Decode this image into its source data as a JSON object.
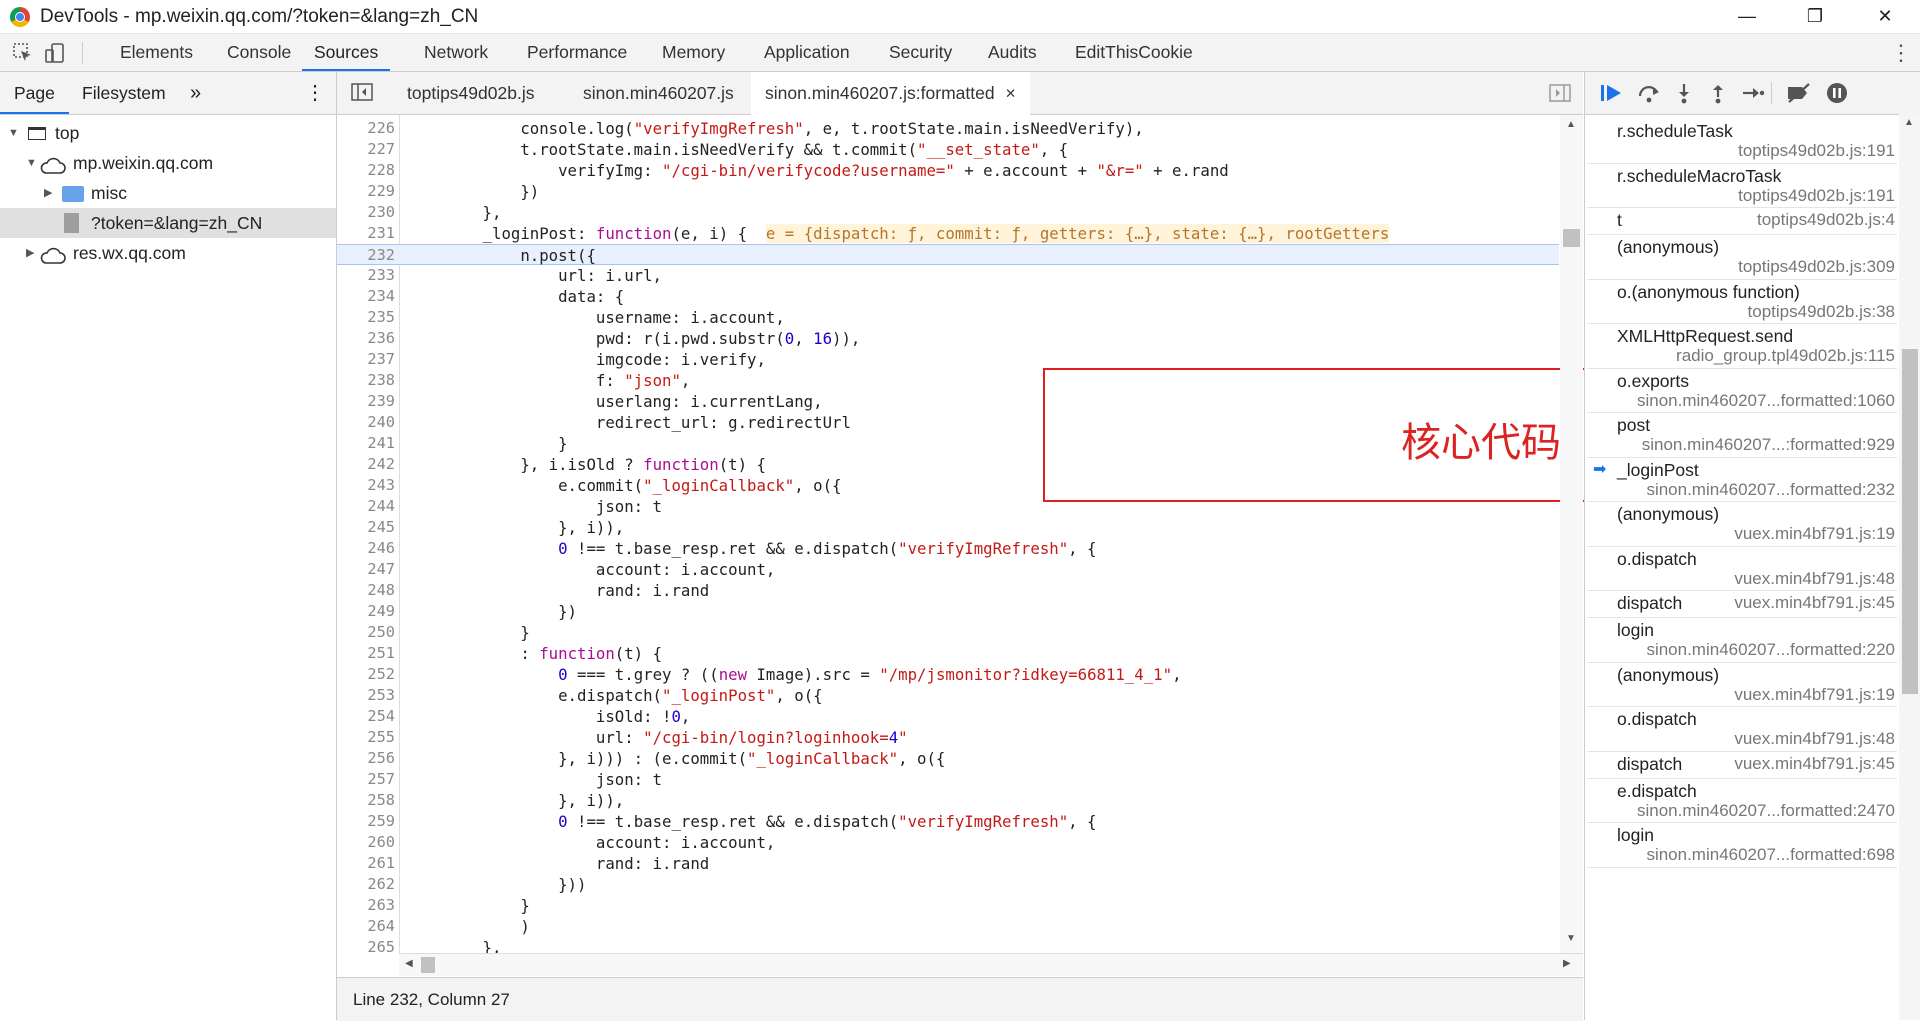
{
  "window": {
    "title": "DevTools - mp.weixin.qq.com/?token=&lang=zh_CN",
    "minimize": "—",
    "maximize": "❐",
    "close": "✕"
  },
  "toolbar": {
    "tabs": [
      "Elements",
      "Console",
      "Sources",
      "Network",
      "Performance",
      "Memory",
      "Application",
      "Security",
      "Audits",
      "EditThisCookie"
    ],
    "active": "Sources",
    "more": "⋮"
  },
  "navigator": {
    "tabs": [
      "Page",
      "Filesystem"
    ],
    "more": "»",
    "menu": "⋮",
    "tree": [
      {
        "label": "top",
        "arrow": "▼"
      },
      {
        "label": "mp.weixin.qq.com",
        "arrow": "▼"
      },
      {
        "label": "misc",
        "arrow": "▶"
      },
      {
        "label": "?token=&lang=zh_CN",
        "arrow": ""
      },
      {
        "label": "res.wx.qq.com",
        "arrow": "▶"
      }
    ]
  },
  "editor": {
    "tabs": [
      "toptips49d02b.js",
      "sinon.min460207.js",
      "sinon.min460207.js:formatted"
    ],
    "tab_close": "×",
    "annotation": "核心代码",
    "status": "Line 232, Column 27",
    "lines": [
      {
        "n": "226",
        "t": "            console.log(\"verifyImgRefresh\", e, t.rootState.main.isNeedVerify),"
      },
      {
        "n": "227",
        "t": "            t.rootState.main.isNeedVerify && t.commit(\"__set_state\", {"
      },
      {
        "n": "228",
        "t": "                verifyImg: \"/cgi-bin/verifycode?username=\" + e.account + \"&r=\" + e.rand"
      },
      {
        "n": "229",
        "t": "            })"
      },
      {
        "n": "230",
        "t": "        },"
      },
      {
        "n": "231",
        "t": "        _loginPost: function(e, i) {  e = {dispatch: ƒ, commit: ƒ, getters: {…}, state: {…}, rootGetters"
      },
      {
        "n": "232",
        "t": "            n.post({"
      },
      {
        "n": "233",
        "t": "                url: i.url,"
      },
      {
        "n": "234",
        "t": "                data: {"
      },
      {
        "n": "235",
        "t": "                    username: i.account,"
      },
      {
        "n": "236",
        "t": "                    pwd: r(i.pwd.substr(0, 16)),"
      },
      {
        "n": "237",
        "t": "                    imgcode: i.verify,"
      },
      {
        "n": "238",
        "t": "                    f: \"json\","
      },
      {
        "n": "239",
        "t": "                    userlang: i.currentLang,"
      },
      {
        "n": "240",
        "t": "                    redirect_url: g.redirectUrl"
      },
      {
        "n": "241",
        "t": "                }"
      },
      {
        "n": "242",
        "t": "            }, i.isOld ? function(t) {"
      },
      {
        "n": "243",
        "t": "                e.commit(\"_loginCallback\", o({"
      },
      {
        "n": "244",
        "t": "                    json: t"
      },
      {
        "n": "245",
        "t": "                }, i)),"
      },
      {
        "n": "246",
        "t": "                0 !== t.base_resp.ret && e.dispatch(\"verifyImgRefresh\", {"
      },
      {
        "n": "247",
        "t": "                    account: i.account,"
      },
      {
        "n": "248",
        "t": "                    rand: i.rand"
      },
      {
        "n": "249",
        "t": "                })"
      },
      {
        "n": "250",
        "t": "            }"
      },
      {
        "n": "251",
        "t": "            : function(t) {"
      },
      {
        "n": "252",
        "t": "                0 === t.grey ? ((new Image).src = \"/mp/jsmonitor?idkey=66811_4_1\","
      },
      {
        "n": "253",
        "t": "                e.dispatch(\"_loginPost\", o({"
      },
      {
        "n": "254",
        "t": "                    isOld: !0,"
      },
      {
        "n": "255",
        "t": "                    url: \"/cgi-bin/login?loginhook=4\""
      },
      {
        "n": "256",
        "t": "                }, i))) : (e.commit(\"_loginCallback\", o({"
      },
      {
        "n": "257",
        "t": "                    json: t"
      },
      {
        "n": "258",
        "t": "                }, i)),"
      },
      {
        "n": "259",
        "t": "                0 !== t.base_resp.ret && e.dispatch(\"verifyImgRefresh\", {"
      },
      {
        "n": "260",
        "t": "                    account: i.account,"
      },
      {
        "n": "261",
        "t": "                    rand: i.rand"
      },
      {
        "n": "262",
        "t": "                }))"
      },
      {
        "n": "263",
        "t": "            }"
      },
      {
        "n": "264",
        "t": "            )"
      },
      {
        "n": "265",
        "t": "        },"
      },
      {
        "n": "266",
        "t": ""
      }
    ]
  },
  "callstack": {
    "frames": [
      {
        "name": "r.scheduleTask",
        "loc": "toptips49d02b.js:191",
        "two": true
      },
      {
        "name": "r.scheduleMacroTask",
        "loc": "toptips49d02b.js:191",
        "two": true
      },
      {
        "name": "t",
        "loc": "toptips49d02b.js:4",
        "two": false
      },
      {
        "name": "(anonymous)",
        "loc": "toptips49d02b.js:309",
        "two": true
      },
      {
        "name": "o.(anonymous function)",
        "loc": "toptips49d02b.js:38",
        "two": true
      },
      {
        "name": "XMLHttpRequest.send",
        "loc": "radio_group.tpl49d02b.js:115",
        "two": true
      },
      {
        "name": "o.exports",
        "loc": "sinon.min460207...formatted:1060",
        "two": true
      },
      {
        "name": "post",
        "loc": "sinon.min460207...:formatted:929",
        "two": true
      },
      {
        "name": "_loginPost",
        "loc": "sinon.min460207...formatted:232",
        "two": true,
        "current": true
      },
      {
        "name": "(anonymous)",
        "loc": "vuex.min4bf791.js:19",
        "two": true
      },
      {
        "name": "o.dispatch",
        "loc": "vuex.min4bf791.js:48",
        "two": true
      },
      {
        "name": "dispatch",
        "loc": "vuex.min4bf791.js:45",
        "two": false
      },
      {
        "name": "login",
        "loc": "sinon.min460207...formatted:220",
        "two": true
      },
      {
        "name": "(anonymous)",
        "loc": "vuex.min4bf791.js:19",
        "two": true
      },
      {
        "name": "o.dispatch",
        "loc": "vuex.min4bf791.js:48",
        "two": true
      },
      {
        "name": "dispatch",
        "loc": "vuex.min4bf791.js:45",
        "two": false
      },
      {
        "name": "e.dispatch",
        "loc": "sinon.min460207...formatted:2470",
        "two": true
      },
      {
        "name": "login",
        "loc": "sinon.min460207...formatted:698",
        "two": true
      }
    ]
  },
  "colors": {
    "accent": "#1a73e8",
    "highlight": "#e8f0fe",
    "annotation": "#e02020"
  }
}
